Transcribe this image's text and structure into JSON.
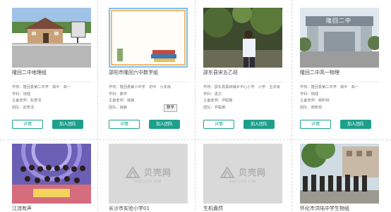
{
  "cards_row1": [
    {
      "title": "隆回二中地理组",
      "school": "学校：隆回县第二中学　高中　高一",
      "subject": "学科：地理",
      "leader": "主备老师：彭爱清",
      "team": "团队：彭爱清",
      "detail_label": "详情",
      "join_label": "加入团队"
    },
    {
      "title": "邵阳市隆回六中数学组",
      "school": "学校：隆回县第六中学　初中　九年级",
      "subject": "学科：数学",
      "leader": "主备老师：姚静",
      "team": "团队：姚静",
      "detail_label": "详情",
      "join_label": "加入团队"
    },
    {
      "title": "邵东县宋五乙班",
      "school": "学校：邵东县黑田铺乡中心小学　小学　五年级",
      "subject": "学科：语文",
      "leader": "主备老师：尹聪媛",
      "team": "团队：尹聪媛",
      "detail_label": "详情",
      "join_label": "加入团队"
    },
    {
      "title": "隆回二中高一物理",
      "school": "学校：隆回县第二中学　高中　高一",
      "subject": "学科：物理",
      "leader": "主备老师：郝昕玥",
      "team": "团队：郝昕玥",
      "detail_label": "详情",
      "join_label": "加入团队"
    }
  ],
  "cards_row2": [
    {
      "title": "江流有声"
    },
    {
      "title": "长沙市实验小学01"
    },
    {
      "title": "生机盎然"
    },
    {
      "title": "怀化市洪陆中学生物组"
    }
  ],
  "tooltip": "数学",
  "placeholder": {
    "brand": "贝壳网",
    "sub": "BAKCLASS.COM"
  },
  "thumb2_chalkboard_text": "数学",
  "thumb4_gate_text": "隆回二中",
  "colors": {
    "accent": "#1ca08c",
    "separator": "#d8d8d8",
    "placeholder_bg": "#d9d9d9"
  }
}
